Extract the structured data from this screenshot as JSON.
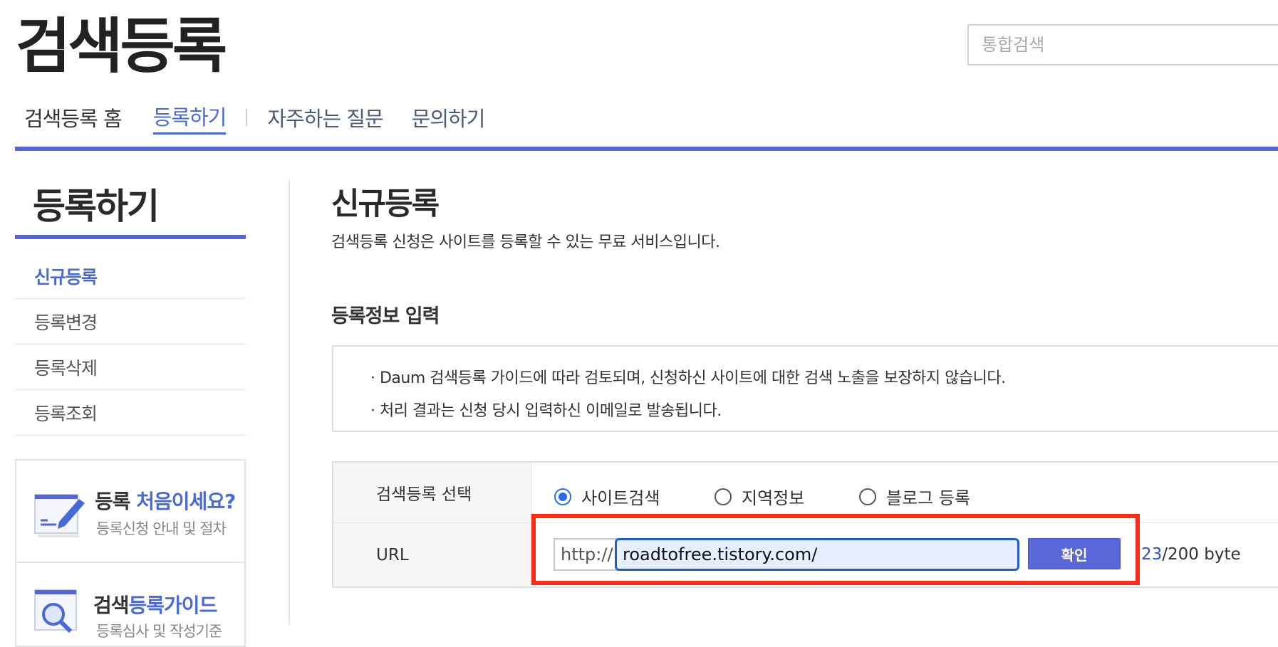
{
  "header": {
    "title": "검색등록",
    "search_placeholder": "통합검색"
  },
  "gnb": {
    "home": "검색등록 홈",
    "register": "등록하기",
    "faq": "자주하는 질문",
    "inquiry": "문의하기"
  },
  "sidebar": {
    "title": "등록하기",
    "items": [
      {
        "label": "신규등록",
        "active": true
      },
      {
        "label": "등록변경",
        "active": false
      },
      {
        "label": "등록삭제",
        "active": false
      },
      {
        "label": "등록조회",
        "active": false
      }
    ],
    "promo1": {
      "title_a": "등록 ",
      "title_b": "처음이세요?",
      "sub": "등록신청 안내 및 절차",
      "icon": "pencil-doc-icon"
    },
    "promo2": {
      "title_a": "검색",
      "title_b": "등록가이드",
      "sub": "등록심사 및 작성기준",
      "icon": "magnifier-doc-icon"
    }
  },
  "content": {
    "title": "신규등록",
    "desc": "검색등록 신청은 사이트를 등록할 수 있는 무료 서비스입니다.",
    "section": "등록정보 입력",
    "notices": [
      "· Daum 검색등록 가이드에 따라 검토되며, 신청하신 사이트에 대한 검색 노출을 보장하지 않습니다.",
      "· 처리 결과는 신청 당시 입력하신 이메일로 발송됩니다."
    ],
    "form": {
      "type_label": "검색등록 선택",
      "options": [
        "사이트검색",
        "지역정보",
        "블로그 등록"
      ],
      "selected": "사이트검색",
      "url_label": "URL",
      "url_prefix": "http://",
      "url_value": "roadtofree.tistory.com/",
      "confirm": "확인",
      "byte_count": "23",
      "byte_max": "/200 byte"
    }
  },
  "colors": {
    "accent": "#5566d8",
    "link": "#4a69d9",
    "highlight": "#ff2a14"
  }
}
